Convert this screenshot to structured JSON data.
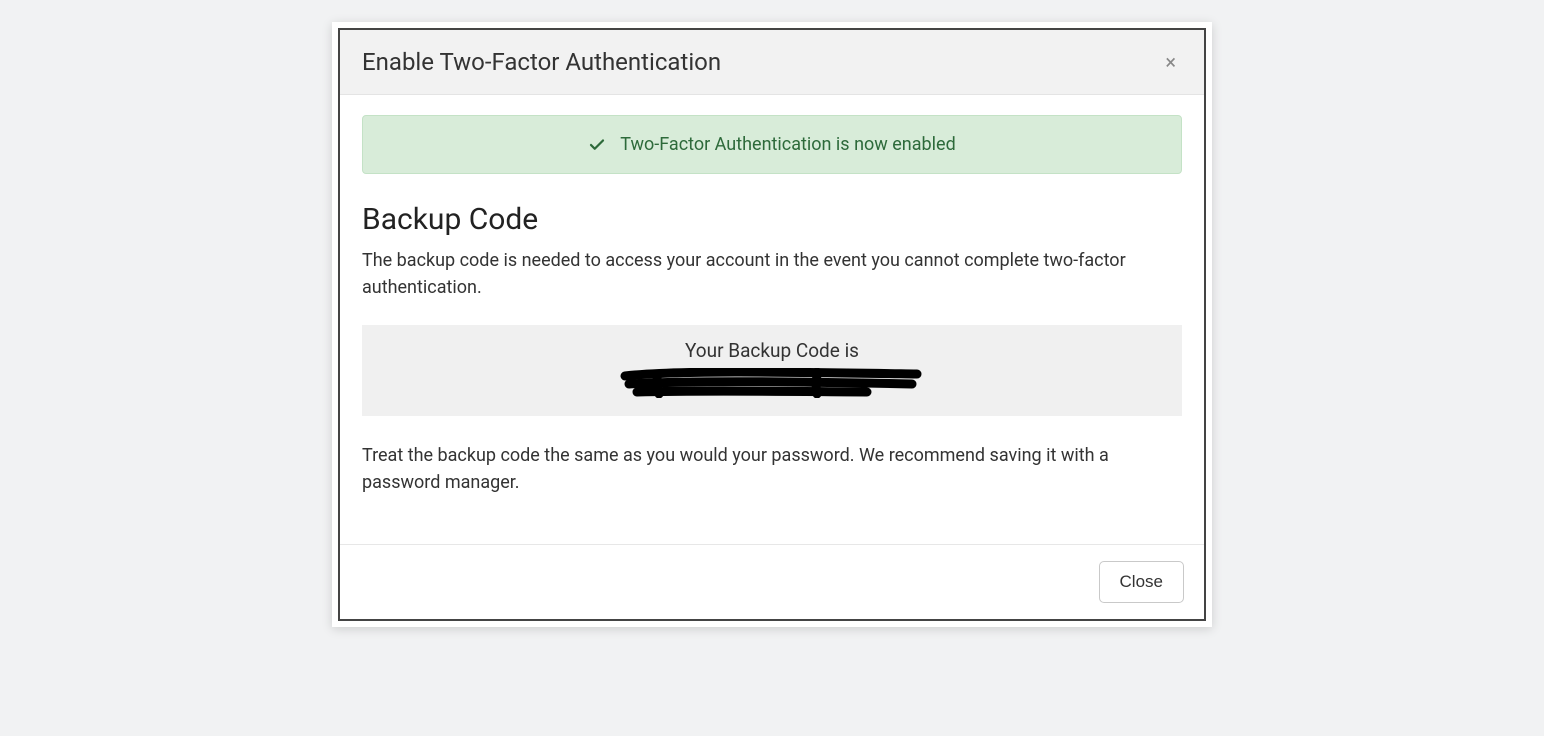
{
  "modal": {
    "title": "Enable Two-Factor Authentication",
    "close_icon": "×",
    "alert": {
      "message": "Two-Factor Authentication is now enabled"
    },
    "section_heading": "Backup Code",
    "description": "The backup code is needed to access your account in the event you cannot complete two-factor authentication.",
    "code_box_label": "Your Backup Code is",
    "backup_code": "[redacted]",
    "advice": "Treat the backup code the same as you would your password. We recommend saving it with a password manager.",
    "close_button_label": "Close"
  }
}
